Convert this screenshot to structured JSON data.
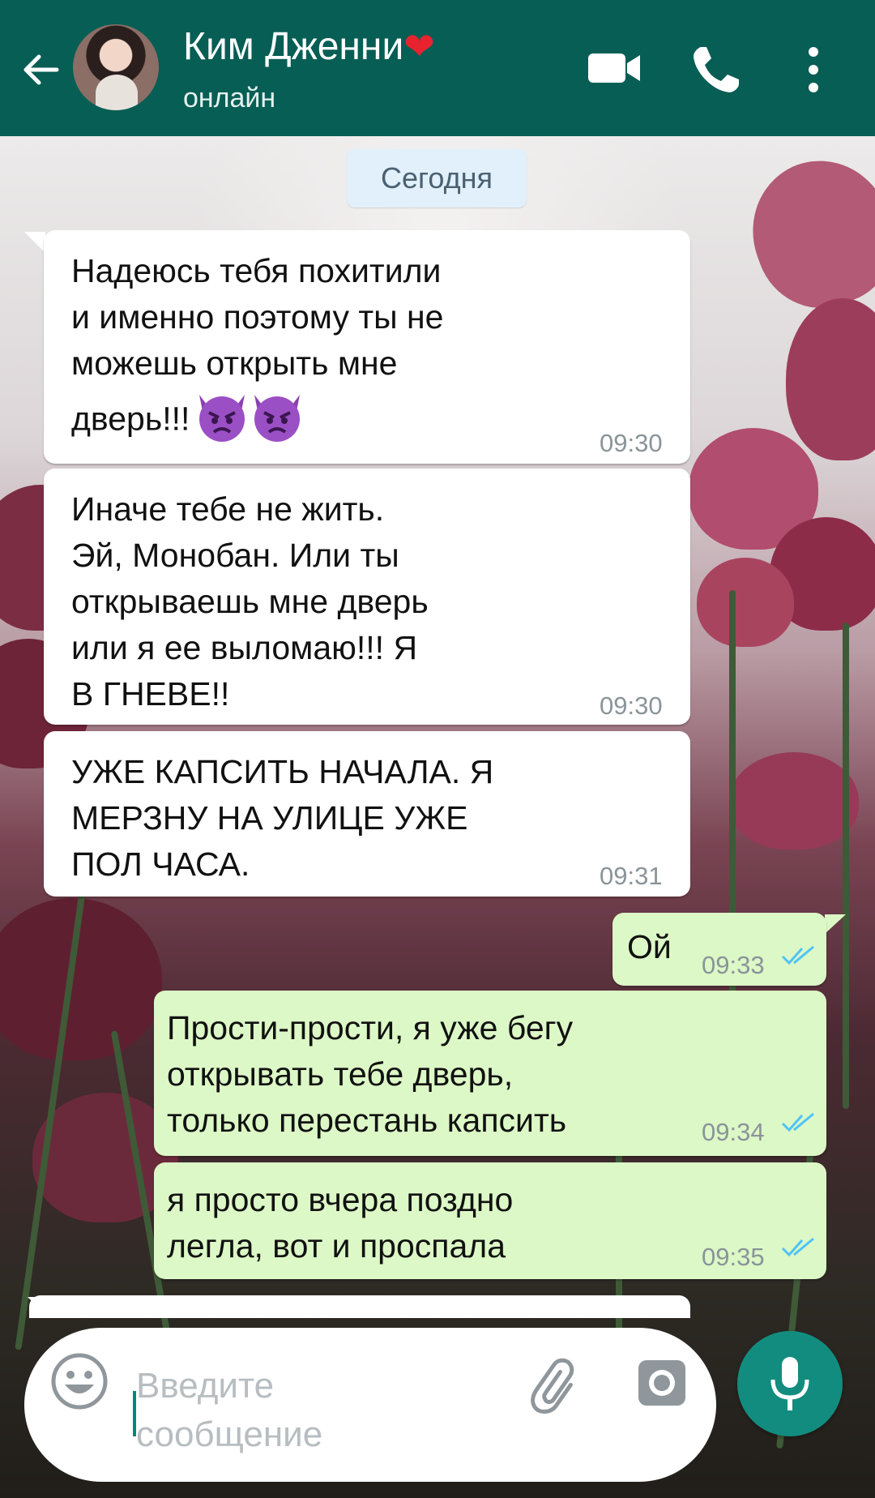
{
  "header": {
    "contact_name": "Ким Дженни",
    "heart": "❤",
    "status": "онлайн",
    "icons": [
      "back-arrow-icon",
      "video-call-icon",
      "phone-icon",
      "more-vertical-icon"
    ]
  },
  "chat": {
    "date_label": "Сегодня",
    "messages": [
      {
        "direction": "in",
        "text": "Надеюсь тебя похитили\nи именно поэтому ты не\nможешь открыть мне\nдверь!!!",
        "emoji": [
          "angry-devil-emoji",
          "angry-devil-emoji"
        ],
        "time": "09:30"
      },
      {
        "direction": "in",
        "text": "Иначе тебе не жить.\nЭй, Монобан. Или ты\nоткрываешь мне дверь\nили я ее выломаю!!!  Я\nВ ГНЕВЕ!!",
        "time": "09:30"
      },
      {
        "direction": "in",
        "text": "УЖЕ КАПСИТЬ НАЧАЛА. Я\nМЕРЗНУ НА УЛИЦЕ УЖЕ\nПОЛ ЧАСА.",
        "time": "09:31"
      },
      {
        "direction": "out",
        "text": "Ой",
        "time": "09:33",
        "status": "read"
      },
      {
        "direction": "out",
        "text": "Прости-прости, я уже бегу\nоткрывать тебе дверь,\nтолько перестань капсить",
        "time": "09:34",
        "status": "read"
      },
      {
        "direction": "out",
        "text": "я просто вчера поздно\nлегла, вот и проспала",
        "time": "09:35",
        "status": "read"
      }
    ]
  },
  "composer": {
    "placeholder": "Введите\nсообщение",
    "icons": [
      "emoji-icon",
      "paperclip-icon",
      "camera-icon",
      "microphone-icon"
    ]
  },
  "colors": {
    "header": "#075e54",
    "outgoing_bubble": "#dcf8c6",
    "incoming_bubble": "#ffffff",
    "read_ticks": "#4fc3f7",
    "mic_button": "#128c7e",
    "date_chip": "#e1f0fa"
  }
}
